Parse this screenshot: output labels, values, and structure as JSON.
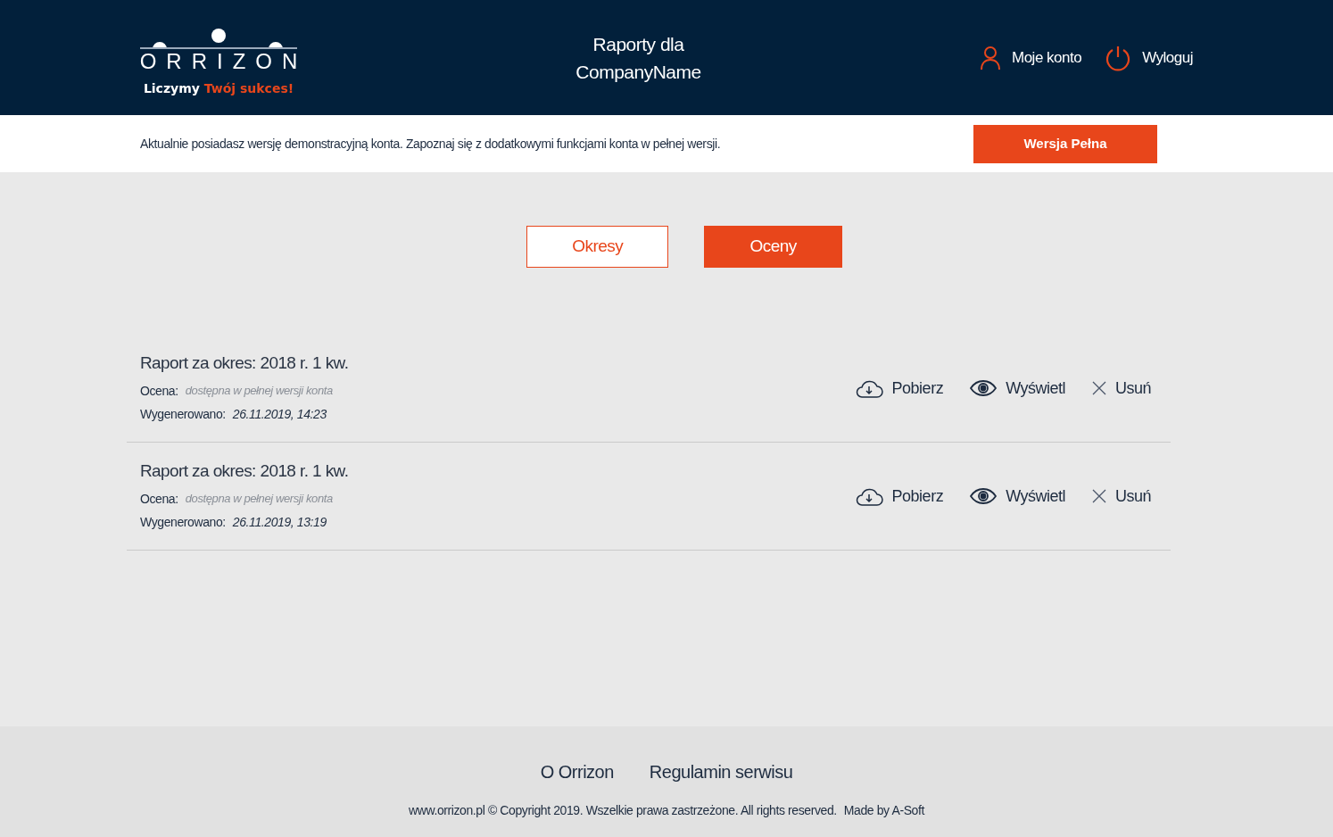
{
  "header": {
    "logo": {
      "wordmark": "ORRIZON",
      "tagline_start": "Liczymy",
      "tagline_accent": "Twój sukces!"
    },
    "title": "Raporty dla CompanyName",
    "account": "Moje konto",
    "logout": "Wyloguj"
  },
  "banner": {
    "message": "Aktualnie posiadasz wersję demonstracyjną konta. Zapoznaj się z dodatkowymi funkcjami konta w pełnej wersji.",
    "button": "Wersja Pełna"
  },
  "tabs": [
    {
      "label": "Okresy",
      "selected": false
    },
    {
      "label": "Oceny",
      "selected": true
    }
  ],
  "reports": [
    {
      "title": "Raport za okres: 2018 r. 1 kw.",
      "rating_label": "Ocena:",
      "rating_value": "dostępna w pełnej wersji konta",
      "generated_label": "Wygenerowano:",
      "generated_value": "26.11.2019, 14:23",
      "download": "Pobierz",
      "view": "Wyświetl",
      "delete": "Usuń"
    },
    {
      "title": "Raport za okres: 2018 r. 1 kw.",
      "rating_label": "Ocena:",
      "rating_value": "dostępna w pełnej wersji konta",
      "generated_label": "Wygenerowano:",
      "generated_value": "26.11.2019, 13:19",
      "download": "Pobierz",
      "view": "Wyświetl",
      "delete": "Usuń"
    }
  ],
  "footer": {
    "links": [
      "O Orrizon",
      "Regulamin serwisu"
    ],
    "copyright": "www.orrizon.pl © Copyright 2019. Wszelkie prawa zastrzeżone. All rights reserved.",
    "credit": "Made by A-Soft"
  }
}
